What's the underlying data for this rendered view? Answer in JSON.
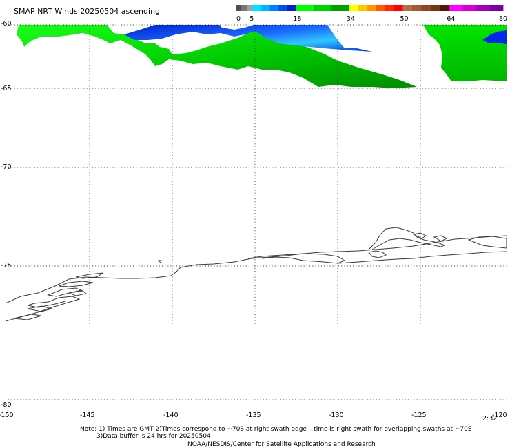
{
  "title": "SMAP NRT Winds 20250504 ascending",
  "colorbar": {
    "tick_labels": [
      "0",
      "5",
      "18",
      "34",
      "50",
      "64",
      "80"
    ],
    "segments": [
      {
        "from": 0,
        "to": 5,
        "colors": [
          "#505050",
          "#787878",
          "#a0a0a0"
        ]
      },
      {
        "from": 5,
        "to": 18,
        "colors": [
          "#00e5ff",
          "#00b4ff",
          "#0080ff",
          "#0050f0",
          "#0020c8"
        ]
      },
      {
        "from": 18,
        "to": 34,
        "colors": [
          "#00ff00",
          "#00d200",
          "#00a000"
        ]
      },
      {
        "from": 34,
        "to": 50,
        "colors": [
          "#ffff00",
          "#ffc800",
          "#ff9600",
          "#ff5a00",
          "#ff2800",
          "#ff0000"
        ]
      },
      {
        "from": 50,
        "to": 64,
        "colors": [
          "#b46e46",
          "#a05a37",
          "#8c4628",
          "#783219",
          "#50140a"
        ]
      },
      {
        "from": 64,
        "to": 80,
        "colors": [
          "#ff00ff",
          "#d200d2",
          "#a000b4",
          "#7800a0"
        ]
      }
    ]
  },
  "latitudes": [
    "-60",
    "-65",
    "-70",
    "-75",
    "-80"
  ],
  "longitudes": [
    "-150",
    "-145",
    "-140",
    "-135",
    "-130",
    "-125",
    "-120"
  ],
  "time_label": "2:32",
  "notes": [
    "Note: 1) Times are GMT 2)Times correspond to ~70S at right swath edge – time is right swath for overlapping swaths at ~70S",
    "3)Data buffer is 24 hrs for 20250504",
    "NOAA/NESDIS/Center for Satellite Applications and Research"
  ],
  "colors": {
    "wind_green_light": "#00ff00",
    "wind_green_dark": "#009600",
    "wind_blue_dark": "#0028e6",
    "wind_blue_light": "#19d2ff",
    "coastline": "#3a3a3a"
  }
}
